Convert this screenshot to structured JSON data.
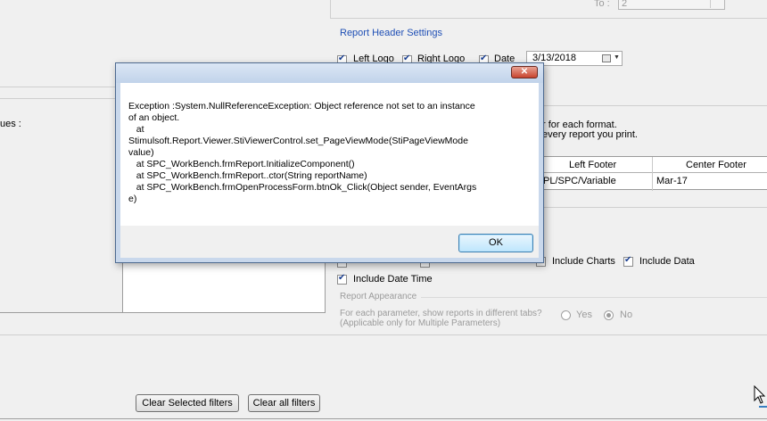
{
  "right_panel": {
    "to_label": "To :",
    "to_value": "2",
    "report_header_label": "Report Header Settings",
    "left_logo_label": "Left Logo",
    "right_logo_label": "Right Logo",
    "date_label": "Date",
    "date_value": "3/13/2018",
    "footer_hint_1": "r for each format.",
    "footer_hint_2": "every report you print.",
    "footer_table": {
      "headers": [
        "Left Footer",
        "Center Footer"
      ],
      "row": [
        "PL/SPC/Variable",
        "Mar-17"
      ]
    },
    "include_charts_label": "Include Charts",
    "include_data_label": "Include Data",
    "include_date_time_label": "Include Date Time",
    "report_appearance_label": "Report Appearance",
    "tabs_question": "For each parameter, show reports in different tabs?",
    "tabs_note": "(Applicable only for Multiple Parameters)",
    "yes_label": "Yes",
    "no_label": "No"
  },
  "left_panel": {
    "values_label": "ues :"
  },
  "buttons": {
    "clear_selected": "Clear Selected filters",
    "clear_all": "Clear all filters"
  },
  "dialog": {
    "close_glyph": "✕",
    "message_lines": [
      "Exception :System.NullReferenceException: Object reference not set to an instance",
      "of an object.",
      "   at",
      "Stimulsoft.Report.Viewer.StiViewerControl.set_PageViewMode(StiPageViewMode",
      "value)",
      "   at SPC_WorkBench.frmReport.InitializeComponent()",
      "   at SPC_WorkBench.frmReport..ctor(String reportName)",
      "   at SPC_WorkBench.frmOpenProcessForm.btnOk_Click(Object sender, EventArgs",
      "e)"
    ],
    "ok_label": "OK"
  }
}
